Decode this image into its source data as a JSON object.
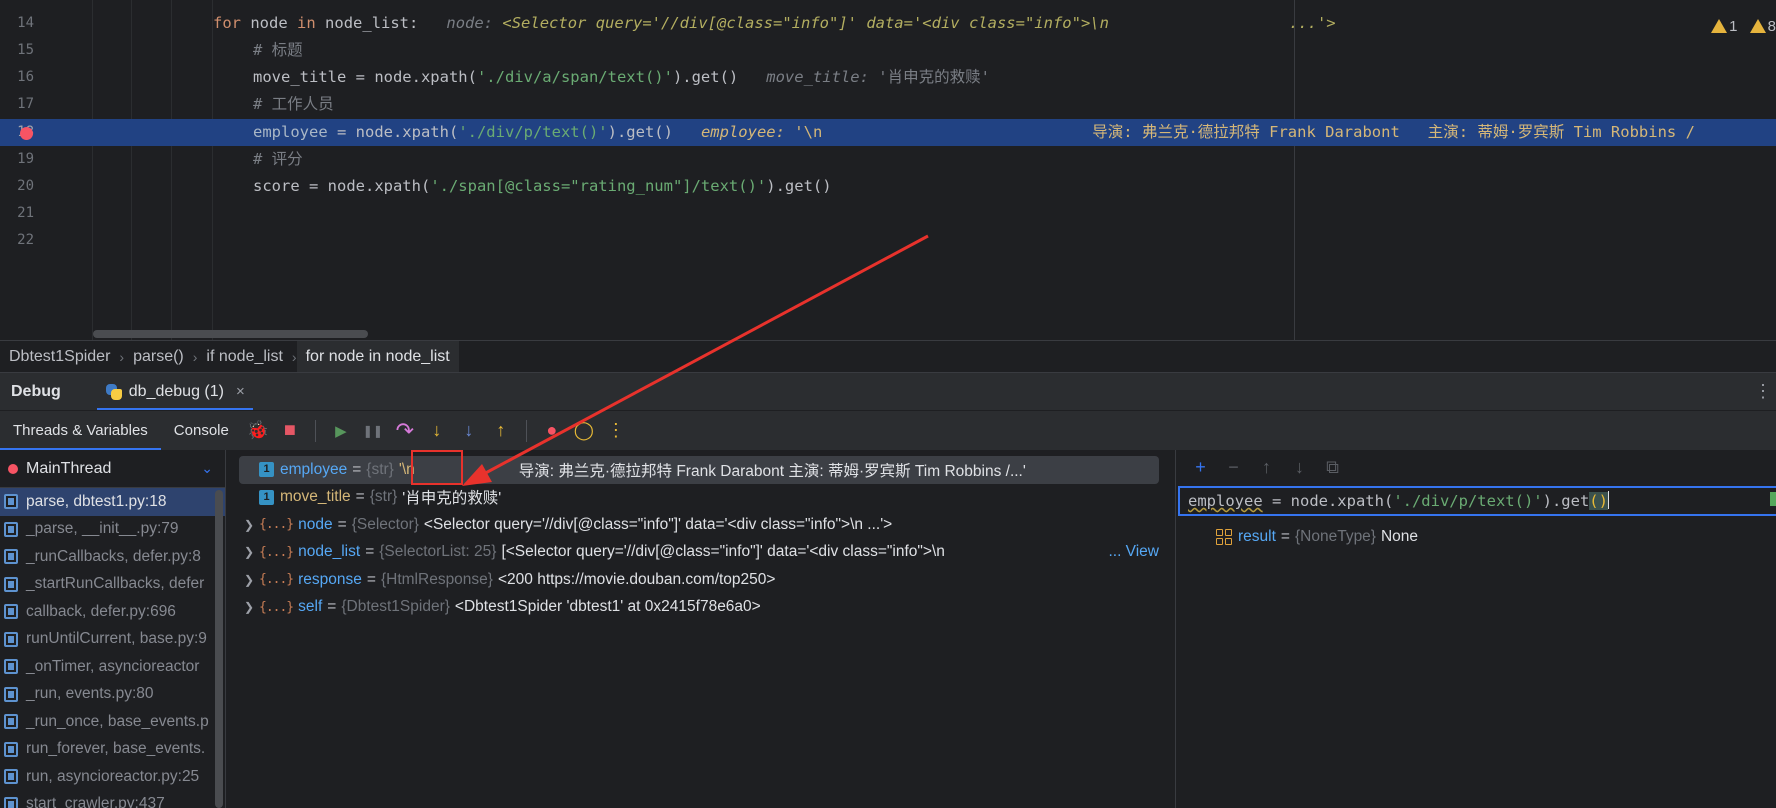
{
  "editor": {
    "line_numbers": [
      "14",
      "15",
      "16",
      "17",
      "18",
      "19",
      "20",
      "21",
      "22"
    ],
    "line14": {
      "kw": "for",
      "var1": "node",
      "kw2": "in",
      "var2": "node_list:",
      "inlay_name": "node:",
      "inlay_value": "<Selector query='//div[@class=\"info\"]' data='<div class=\"info\">\\n",
      "inlay_tail": "...'>"
    },
    "line15": {
      "comment": "# 标题"
    },
    "line16": {
      "code_start": "move_title = node.xpath(",
      "string": "'./div/a/span/text()'",
      "code_end": ").get()",
      "inlay_name": "move_title:",
      "inlay_value": "'肖申克的救赎'"
    },
    "line17": {
      "comment": "# 工作人员"
    },
    "line18": {
      "code_var": "employee",
      "code_mid": " = node.xpath(",
      "string": "'./div/p/text()'",
      "code_end": ").get()",
      "inlay_name": "employee:",
      "inlay_value": "'\\n",
      "inlay_rest": "导演: 弗兰克·德拉邦特 Frank Darabont   主演: 蒂姆·罗宾斯 Tim Robbins /"
    },
    "line19": {
      "comment": "# 评分"
    },
    "line20": {
      "code_start": "score = node.xpath(",
      "string": "'./span[@class=\"rating_num\"]/text()'",
      "code_end": ").get()"
    },
    "warnings": {
      "warn_count": "1",
      "weak_count": "8"
    }
  },
  "breadcrumb": {
    "items": [
      "Dbtest1Spider",
      "parse()",
      "if node_list",
      "for node in node_list"
    ],
    "separator": "›"
  },
  "debug": {
    "title": "Debug",
    "run_tab_label": "db_debug (1)",
    "close_glyph": "×",
    "more_glyph": "⋮",
    "subtabs": [
      "Threads & Variables",
      "Console"
    ]
  },
  "toolbar_icons": {
    "bug": "🐞",
    "stop": "■",
    "resume": "▶",
    "pause": "❚❚",
    "step_over": "↷",
    "step_into": "↓",
    "step_into_my": "↓",
    "step_out": "↑",
    "breakpoints": "●",
    "mute": "◯",
    "more": "⋮"
  },
  "colors": {
    "accent": "#3574f0",
    "breakpoint": "#f75464",
    "highlight_line": "#214283",
    "annotation_red": "#e8322c"
  },
  "threads": {
    "current": "MainThread",
    "frames": [
      "parse, dbtest1.py:18",
      "_parse, __init__.py:79",
      "_runCallbacks, defer.py:8",
      "_startRunCallbacks, defer",
      "callback, defer.py:696",
      "runUntilCurrent, base.py:9",
      "_onTimer, asyncioreactor",
      "_run, events.py:80",
      "_run_once, base_events.p",
      "run_forever, base_events.",
      "run, asyncioreactor.py:25",
      "start_crawler.py:437"
    ]
  },
  "variables": [
    {
      "name": "employee",
      "type": "{str}",
      "value": "'\\n",
      "value_rest": "导演: 弗兰克·德拉邦特 Frank Darabont   主演: 蒂姆·罗宾斯 Tim Robbins /...'",
      "expandable": false,
      "badge": "1"
    },
    {
      "name": "move_title",
      "type": "{str}",
      "value": "'肖申克的救赎'",
      "expandable": false,
      "badge": "1"
    },
    {
      "name": "node",
      "type": "{Selector}",
      "value": "<Selector query='//div[@class=\"info\"]' data='<div class=\"info\">\\n                 ...'>",
      "expandable": true,
      "badge": "{...}"
    },
    {
      "name": "node_list",
      "type": "{SelectorList: 25}",
      "value": "[<Selector query='//div[@class=\"info\"]' data='<div class=\"info\">\\n",
      "view": "... View",
      "expandable": true,
      "badge": "{...}"
    },
    {
      "name": "response",
      "type": "{HtmlResponse}",
      "value": "<200 https://movie.douban.com/top250>",
      "expandable": true,
      "badge": "{...}"
    },
    {
      "name": "self",
      "type": "{Dbtest1Spider}",
      "value": "<Dbtest1Spider 'dbtest1' at 0x2415f78e6a0>",
      "expandable": true,
      "badge": "{...}"
    }
  ],
  "evaluate": {
    "toolbar": [
      "+",
      "−",
      "↑",
      "↓",
      "⧉"
    ],
    "expr_var": "employee",
    "expr_mid": " = node.xpath(",
    "expr_string": "'./div/p/text()'",
    "expr_end": ").get",
    "expr_parens": "()",
    "result_name": "result",
    "result_type": "{NoneType}",
    "result_value": "None"
  }
}
